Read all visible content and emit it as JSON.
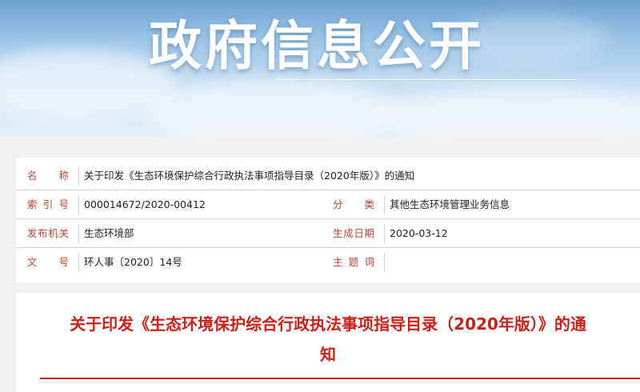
{
  "banner": {
    "title": "政府信息公开"
  },
  "meta": {
    "rows": [
      {
        "label": "名　称",
        "value": "关于印发《生态环境保护综合行政执法事项指导目录（2020年版）》的通知",
        "label2": "",
        "value2": ""
      },
      {
        "label": "索引号",
        "value": "000014672/2020-00412",
        "label2": "分　类",
        "value2": "其他生态环境管理业务信息"
      },
      {
        "label": "发布机关",
        "value": "生态环境部",
        "label2": "生成日期",
        "value2": "2020-03-12"
      },
      {
        "label": "文　号",
        "value": "环人事〔2020〕14号",
        "label2": "主题词",
        "value2": ""
      }
    ]
  },
  "document": {
    "title": "关于印发《生态环境保护综合行政执法事项指导目录（2020年版）》的通知"
  },
  "colors": {
    "label_red": "#c4402f",
    "title_red": "#cc1f16",
    "banner_sky": "#9cc4e6"
  }
}
